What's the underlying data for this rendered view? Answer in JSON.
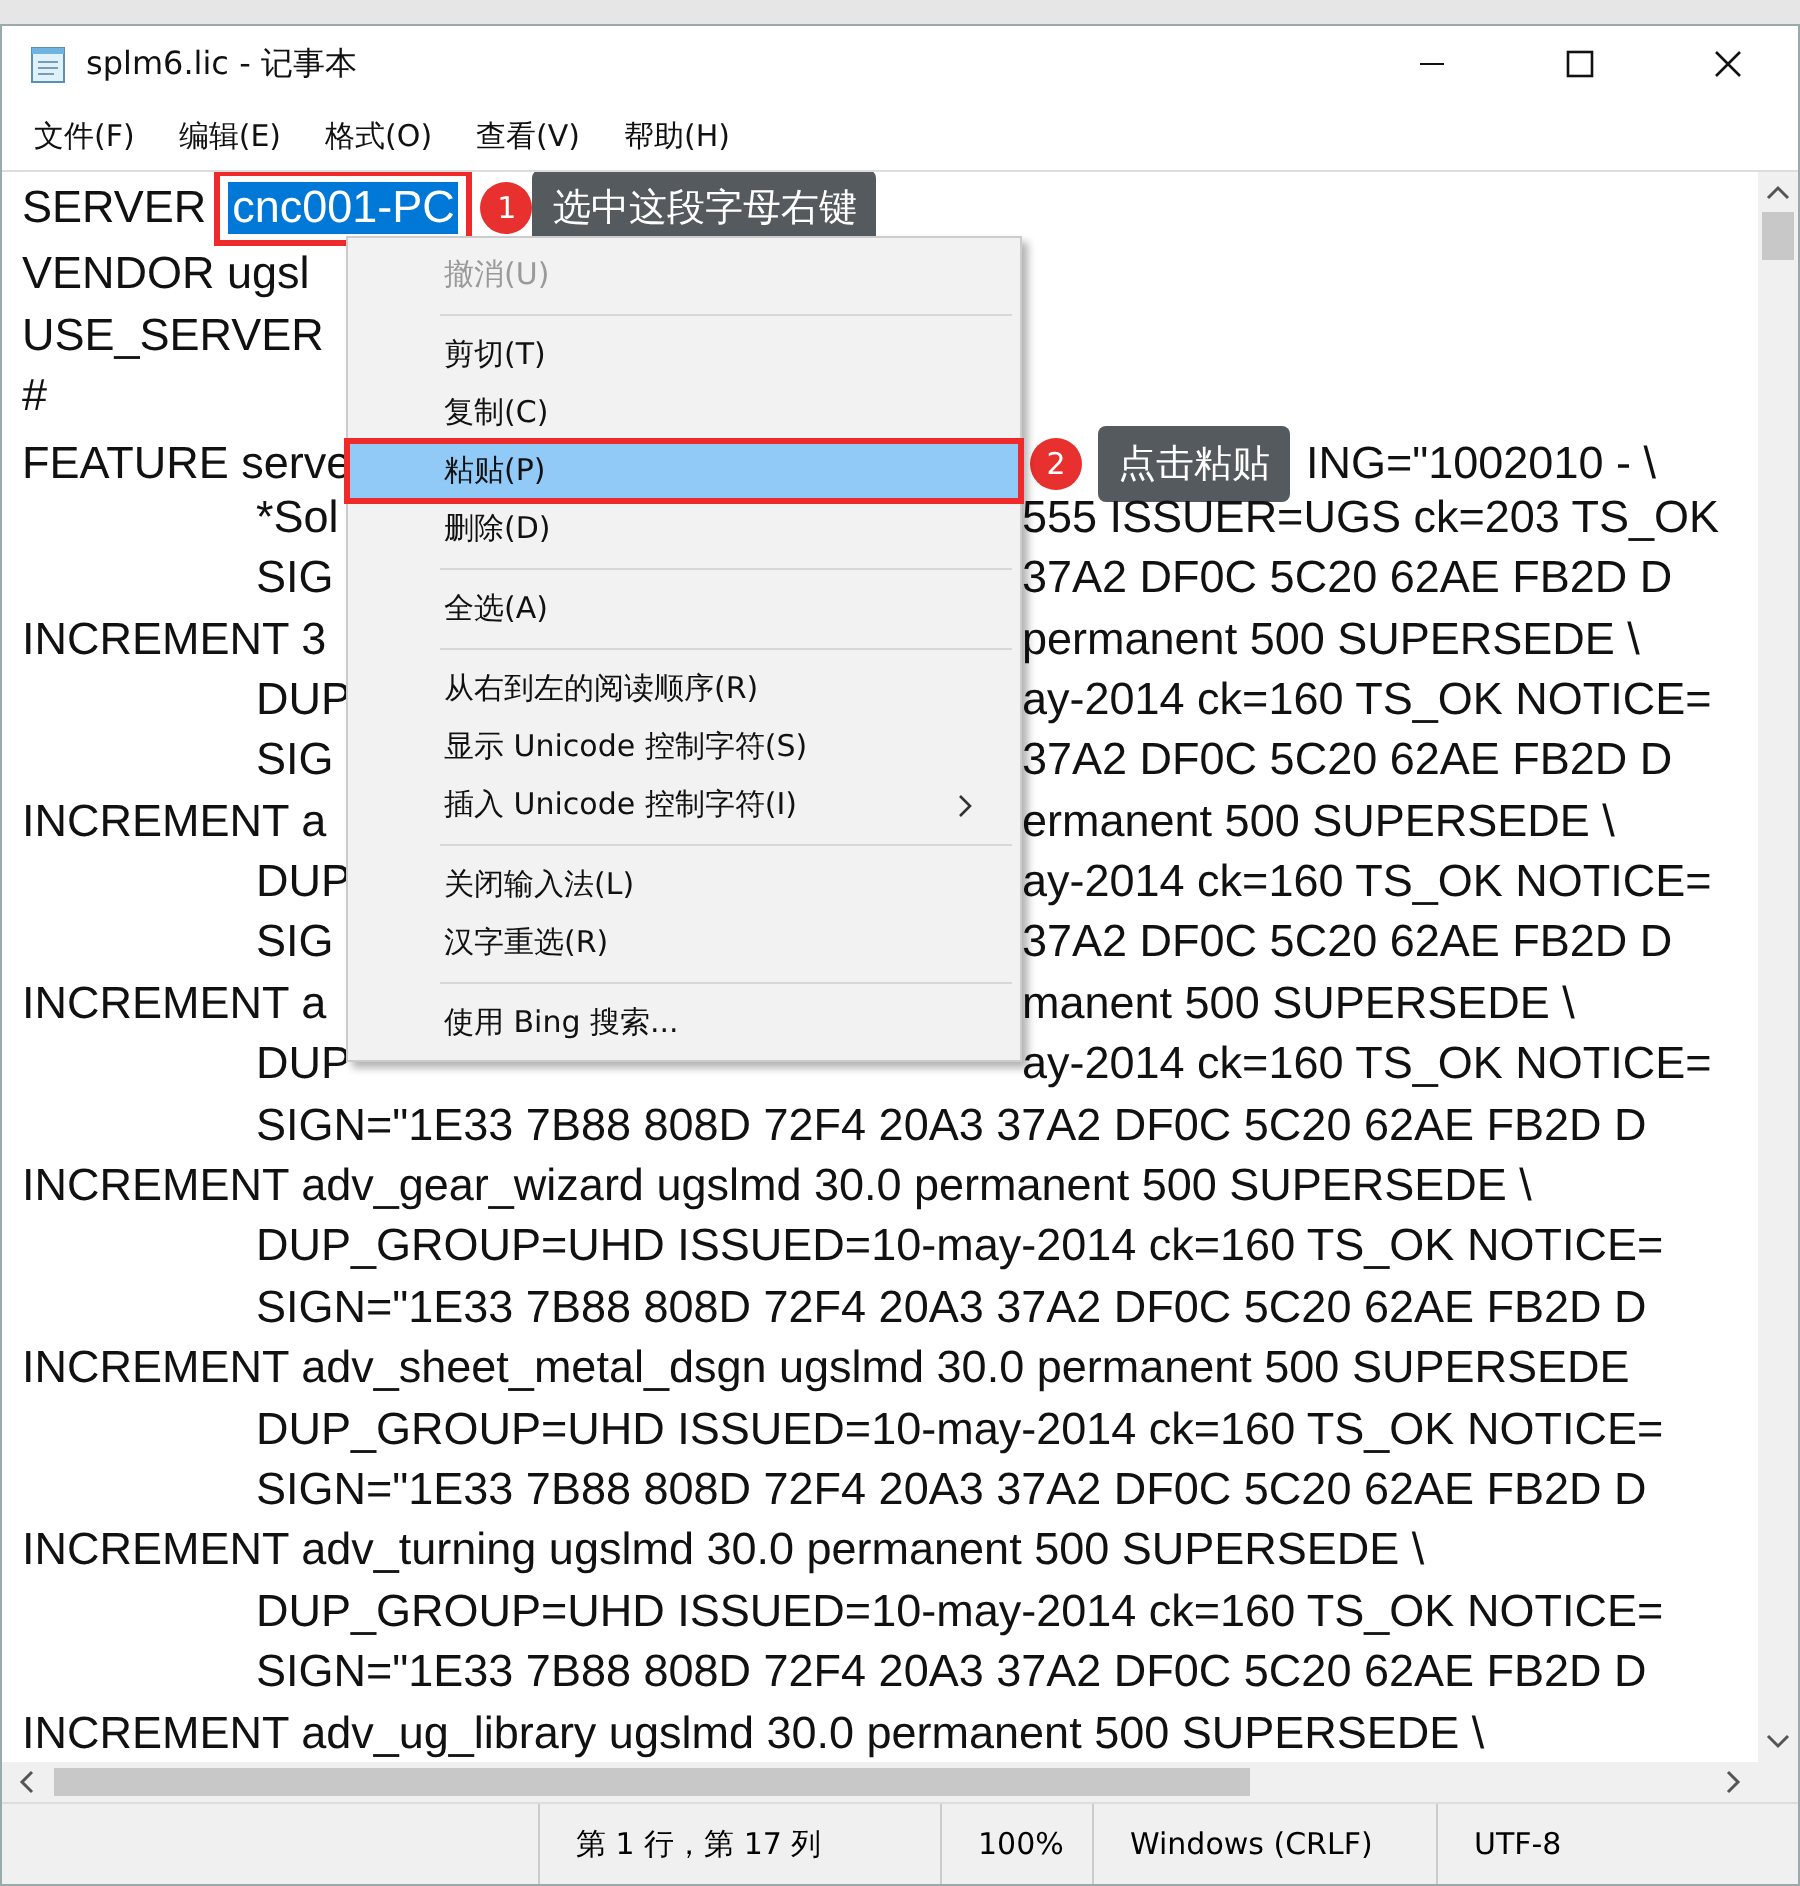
{
  "window": {
    "title": "splm6.lic - 记事本"
  },
  "menu_bar": [
    "文件(F)",
    "编辑(E)",
    "格式(O)",
    "查看(V)",
    "帮助(H)"
  ],
  "editor": {
    "lines": [
      {
        "text": "SERVER",
        "selection": "cnc001-PC",
        "callout": {
          "number": "1",
          "text": "选中这段字母右键"
        }
      },
      {
        "text": "VENDOR ugsl"
      },
      {
        "text": "USE_SERVER"
      },
      {
        "text": "#"
      },
      {
        "text": "FEATURE serve",
        "text_right": "ING=\"1002010 - \\",
        "callout": {
          "number": "2",
          "text": "点击粘贴"
        },
        "children": [
          {
            "text": "*Sol",
            "text_right": "555 ISSUER=UGS ck=203 TS_OK"
          },
          {
            "text": "SIG",
            "text_right": "37A2 DF0C 5C20 62AE FB2D D"
          }
        ]
      },
      {
        "text": "INCREMENT 3",
        "text_right": "permanent 500 SUPERSEDE \\",
        "children": [
          {
            "text": "DUP",
            "text_right": "ay-2014 ck=160 TS_OK NOTICE="
          },
          {
            "text": "SIG",
            "text_right": "37A2 DF0C 5C20 62AE FB2D D"
          }
        ]
      },
      {
        "text": "INCREMENT a",
        "text_right": "ermanent 500 SUPERSEDE \\",
        "children": [
          {
            "text": "DUP",
            "text_right": "ay-2014 ck=160 TS_OK NOTICE="
          },
          {
            "text": "SIG",
            "text_right": "37A2 DF0C 5C20 62AE FB2D D"
          }
        ]
      },
      {
        "text": "INCREMENT a",
        "text_right": "manent 500 SUPERSEDE \\",
        "children": [
          {
            "text": "DUP",
            "text_right": "ay-2014 ck=160 TS_OK NOTICE="
          },
          {
            "text": "SIGN=\"1E33 7B88 808D 72F4 20A3 37A2 DF0C 5C20 62AE FB2D D"
          }
        ]
      },
      {
        "text": "INCREMENT adv_gear_wizard ugslmd 30.0 permanent 500 SUPERSEDE \\",
        "children": [
          {
            "text": "DUP_GROUP=UHD ISSUED=10-may-2014 ck=160 TS_OK NOTICE="
          },
          {
            "text": "SIGN=\"1E33 7B88 808D 72F4 20A3 37A2 DF0C 5C20 62AE FB2D D"
          }
        ]
      },
      {
        "text": "INCREMENT adv_sheet_metal_dsgn ugslmd 30.0 permanent 500 SUPERSEDE",
        "children": [
          {
            "text": "DUP_GROUP=UHD ISSUED=10-may-2014 ck=160 TS_OK NOTICE="
          },
          {
            "text": "SIGN=\"1E33 7B88 808D 72F4 20A3 37A2 DF0C 5C20 62AE FB2D D"
          }
        ]
      },
      {
        "text": "INCREMENT adv_turning ugslmd 30.0 permanent 500 SUPERSEDE \\",
        "children": [
          {
            "text": "DUP_GROUP=UHD ISSUED=10-may-2014 ck=160 TS_OK NOTICE="
          },
          {
            "text": "SIGN=\"1E33 7B88 808D 72F4 20A3 37A2 DF0C 5C20 62AE FB2D D"
          }
        ]
      },
      {
        "text": "INCREMENT adv_ug_library ugslmd 30.0 permanent 500 SUPERSEDE \\"
      }
    ]
  },
  "context_menu": [
    {
      "kind": "item",
      "label": "撤消(U)",
      "disabled": true,
      "selected": false
    },
    {
      "kind": "separator"
    },
    {
      "kind": "item",
      "label": "剪切(T)",
      "disabled": false,
      "selected": false
    },
    {
      "kind": "item",
      "label": "复制(C)",
      "disabled": false,
      "selected": false
    },
    {
      "kind": "item",
      "label": "粘贴(P)",
      "disabled": false,
      "selected": true,
      "boxed": true
    },
    {
      "kind": "item",
      "label": "删除(D)",
      "disabled": false,
      "selected": false
    },
    {
      "kind": "separator"
    },
    {
      "kind": "item",
      "label": "全选(A)",
      "disabled": false,
      "selected": false
    },
    {
      "kind": "separator"
    },
    {
      "kind": "item",
      "label": "从右到左的阅读顺序(R)",
      "disabled": false,
      "selected": false
    },
    {
      "kind": "item",
      "label": "显示 Unicode 控制字符(S)",
      "disabled": false,
      "selected": false
    },
    {
      "kind": "item",
      "label": "插入 Unicode 控制字符(I)",
      "disabled": false,
      "selected": false,
      "submenu": true
    },
    {
      "kind": "separator"
    },
    {
      "kind": "item",
      "label": "关闭输入法(L)",
      "disabled": false,
      "selected": false
    },
    {
      "kind": "item",
      "label": "汉字重选(R)",
      "disabled": false,
      "selected": false
    },
    {
      "kind": "separator"
    },
    {
      "kind": "item",
      "label": "使用 Bing 搜索...",
      "disabled": false,
      "selected": false
    }
  ],
  "status_bar": [
    "第 1 行，第 17 列",
    "100%",
    "Windows (CRLF)",
    "UTF-8"
  ]
}
